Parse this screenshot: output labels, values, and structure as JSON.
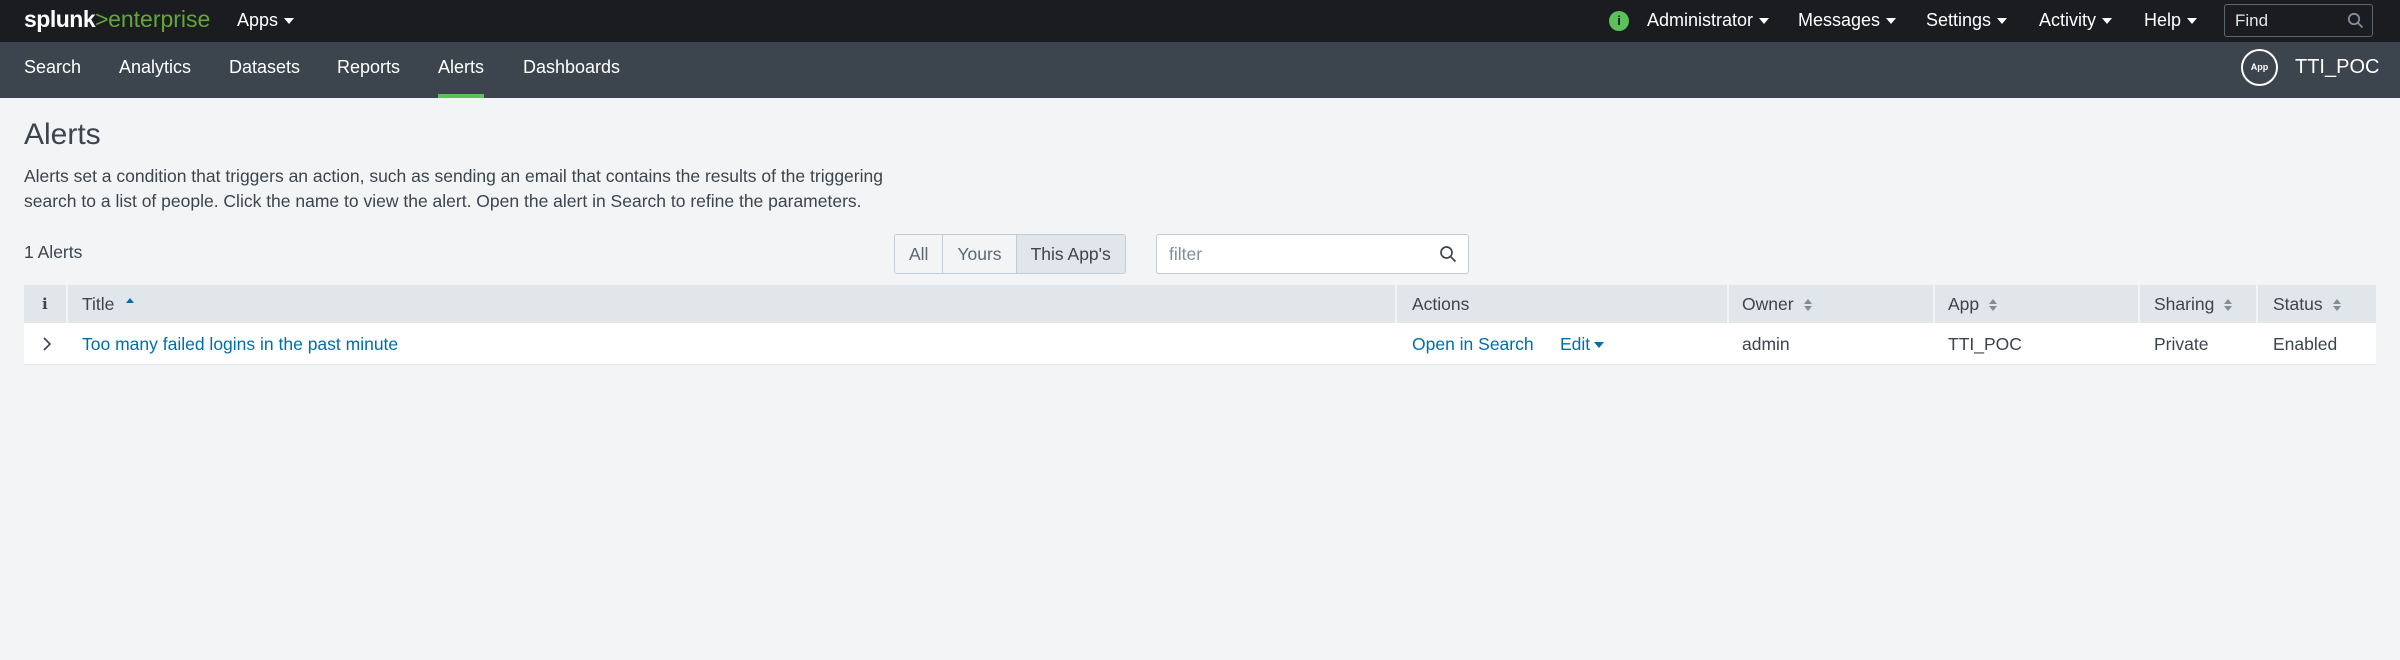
{
  "topbar": {
    "logo_brand": "splunk",
    "logo_gt": ">",
    "logo_product": "enterprise",
    "apps_label": "Apps",
    "info_badge": "i",
    "user_label": "Administrator",
    "messages_label": "Messages",
    "settings_label": "Settings",
    "activity_label": "Activity",
    "help_label": "Help",
    "find_placeholder": "Find"
  },
  "appbar": {
    "tabs": [
      {
        "label": "Search"
      },
      {
        "label": "Analytics"
      },
      {
        "label": "Datasets"
      },
      {
        "label": "Reports"
      },
      {
        "label": "Alerts",
        "active": true
      },
      {
        "label": "Dashboards"
      }
    ],
    "app_icon_text": "App",
    "app_name": "TTI_POC"
  },
  "page": {
    "title": "Alerts",
    "description": "Alerts set a condition that triggers an action, such as sending an email that contains the results of the triggering search to a list of people. Click the name to view the alert. Open the alert in Search to refine the parameters.",
    "count_label": "1 Alerts",
    "scope_buttons": [
      {
        "label": "All"
      },
      {
        "label": "Yours"
      },
      {
        "label": "This App's",
        "selected": true
      }
    ],
    "filter_placeholder": "filter"
  },
  "table": {
    "headers": {
      "info": "i",
      "title": "Title",
      "actions": "Actions",
      "owner": "Owner",
      "app": "App",
      "sharing": "Sharing",
      "status": "Status"
    },
    "rows": [
      {
        "title": "Too many failed logins in the past minute",
        "open_in_search": "Open in Search",
        "edit": "Edit",
        "owner": "admin",
        "app": "TTI_POC",
        "sharing": "Private",
        "status": "Enabled"
      }
    ]
  },
  "colors": {
    "topbar_bg": "#1a1c20",
    "appbar_bg": "#3c444d",
    "accent_green": "#5cc05c",
    "link_blue": "#006eaa",
    "page_bg": "#f2f4f5"
  },
  "icons": [
    "info-icon",
    "search-icon",
    "caret-down-icon",
    "sort-icon",
    "chevron-right-icon"
  ]
}
